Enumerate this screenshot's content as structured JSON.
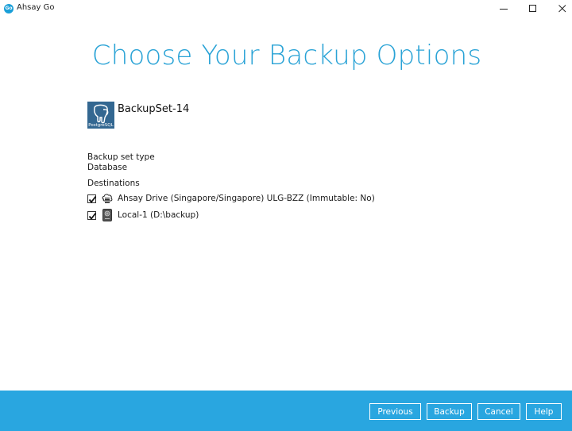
{
  "window": {
    "app_icon_text": "Go",
    "title": "Ahsay Go",
    "controls": [
      "minimize-icon",
      "maximize-icon",
      "close-icon"
    ]
  },
  "main": {
    "title": "Choose Your Backup Options"
  },
  "backup_set": {
    "name": "BackupSet-14",
    "logo_text": "PostgreSQL",
    "logo_icon": "postgresql-elephant-icon",
    "type_label": "Backup set type",
    "type_value": "Database",
    "destinations_label": "Destinations",
    "destinations": [
      {
        "text": "Ahsay Drive (Singapore/Singapore) ULG-BZZ (Immutable: No)",
        "checked": true,
        "icon": "cloud-drive-icon"
      },
      {
        "text": "Local-1 (D:\\backup)",
        "checked": true,
        "icon": "local-disk-icon"
      }
    ]
  },
  "footer": {
    "previous": "Previous",
    "backup": "Backup",
    "cancel": "Cancel",
    "help": "Help"
  },
  "colors": {
    "accent": "#2aa3d6",
    "footer_bg": "#29a6e0",
    "postgres_blue": "#336791"
  }
}
